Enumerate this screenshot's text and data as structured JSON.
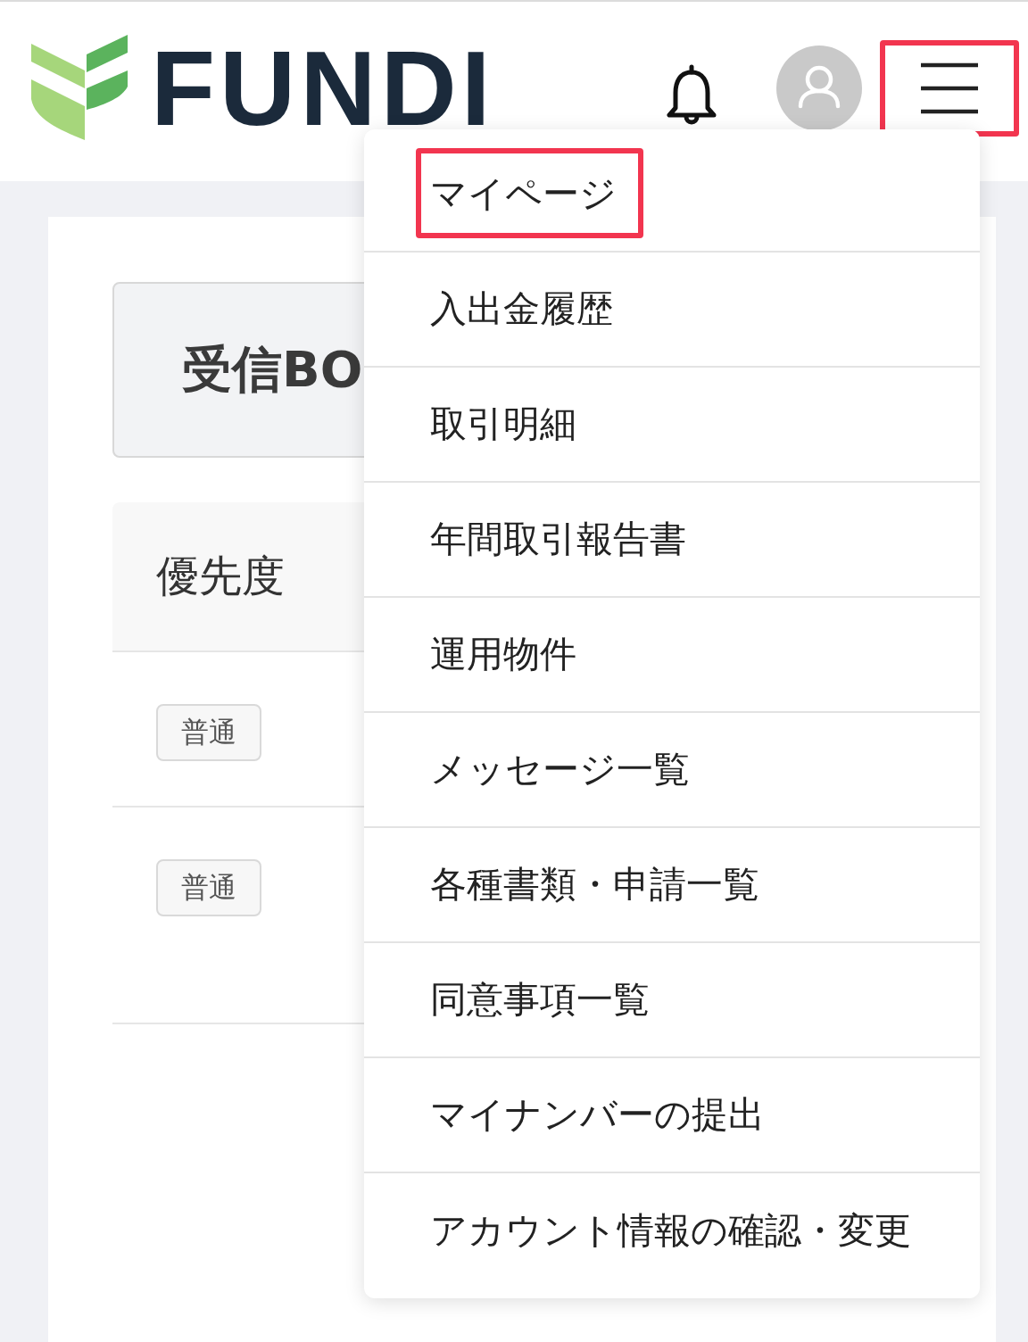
{
  "header": {
    "logo": {
      "wordmark": "FUNDI"
    },
    "menu_button": {
      "highlighted": true
    }
  },
  "inbox": {
    "title": "受信BO"
  },
  "table": {
    "columns": [
      {
        "label": "優先度"
      }
    ],
    "rows": [
      {
        "priority": "普通"
      },
      {
        "priority": "普通"
      }
    ]
  },
  "menu": {
    "items": [
      {
        "label": "マイページ",
        "highlighted": true
      },
      {
        "label": "入出金履歴",
        "highlighted": false
      },
      {
        "label": "取引明細",
        "highlighted": false
      },
      {
        "label": "年間取引報告書",
        "highlighted": false
      },
      {
        "label": "運用物件",
        "highlighted": false
      },
      {
        "label": "メッセージ一覧",
        "highlighted": false
      },
      {
        "label": "各種書類・申請一覧",
        "highlighted": false
      },
      {
        "label": "同意事項一覧",
        "highlighted": false
      },
      {
        "label": "マイナンバーの提出",
        "highlighted": false
      },
      {
        "label": "アカウント情報の確認・変更",
        "highlighted": false
      }
    ]
  }
}
